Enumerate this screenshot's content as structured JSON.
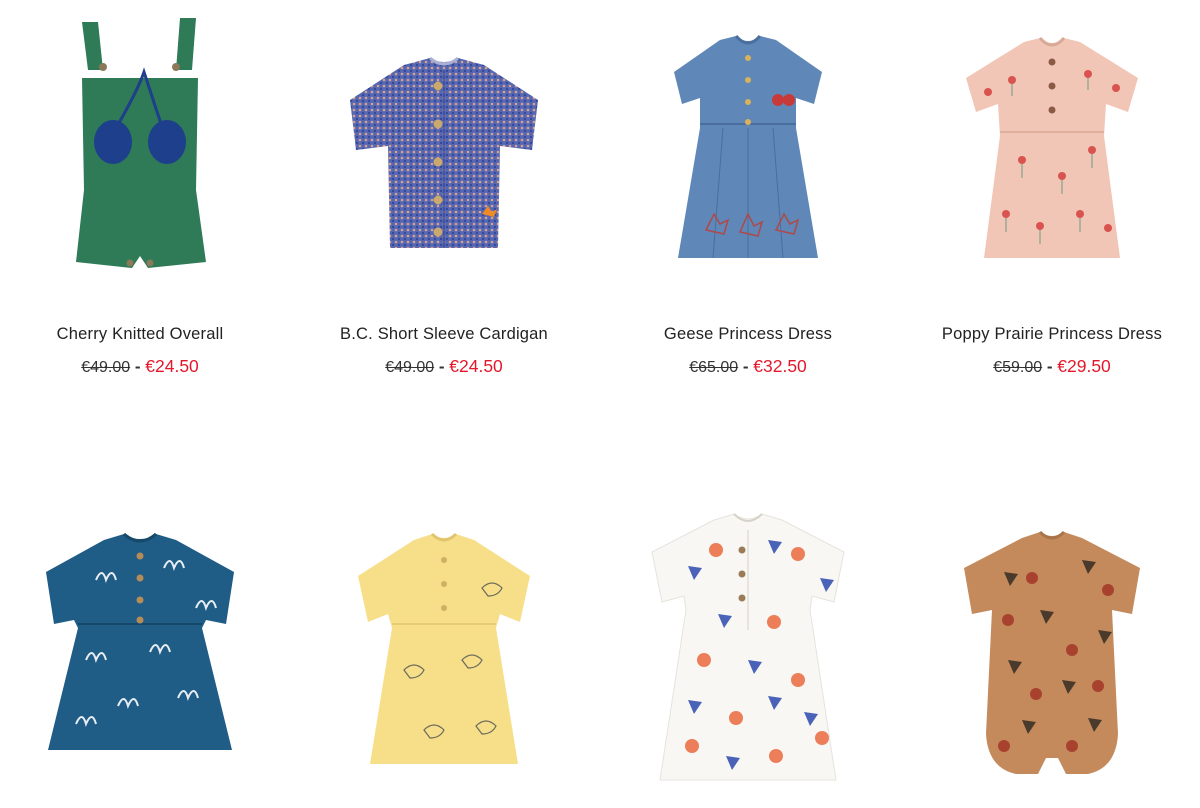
{
  "products": [
    {
      "name": "Cherry Knitted Overall",
      "old_price": "€49.00",
      "separator": "-",
      "price": "€24.50",
      "icon": "green-knitted-overall-image"
    },
    {
      "name": "B.C. Short Sleeve Cardigan",
      "old_price": "€49.00",
      "separator": "-",
      "price": "€24.50",
      "icon": "blue-melange-cardigan-image"
    },
    {
      "name": "Geese Princess Dress",
      "old_price": "€65.00",
      "separator": "-",
      "price": "€32.50",
      "icon": "denim-dress-image"
    },
    {
      "name": "Poppy Prairie Princess Dress",
      "old_price": "€59.00",
      "separator": "-",
      "price": "€29.50",
      "icon": "pink-floral-dress-image"
    },
    {
      "icon": "blue-printed-dress-image"
    },
    {
      "icon": "yellow-bird-dress-image"
    },
    {
      "icon": "white-geometric-dress-image"
    },
    {
      "icon": "brown-geometric-romper-image"
    }
  ],
  "colors": {
    "sale_price": "#e4182b",
    "text": "#222222",
    "overall_green": "#2f7a57",
    "cherry_navy": "#1d3f8c",
    "cardigan_blue": "#4f62b0",
    "denim": "#5f87b8",
    "pink": "#f1c6b6",
    "dress_blue": "#1f5c86",
    "yellow": "#f7df8a",
    "white_dress": "#f8f7f3",
    "romper_brown": "#c48a5c"
  }
}
